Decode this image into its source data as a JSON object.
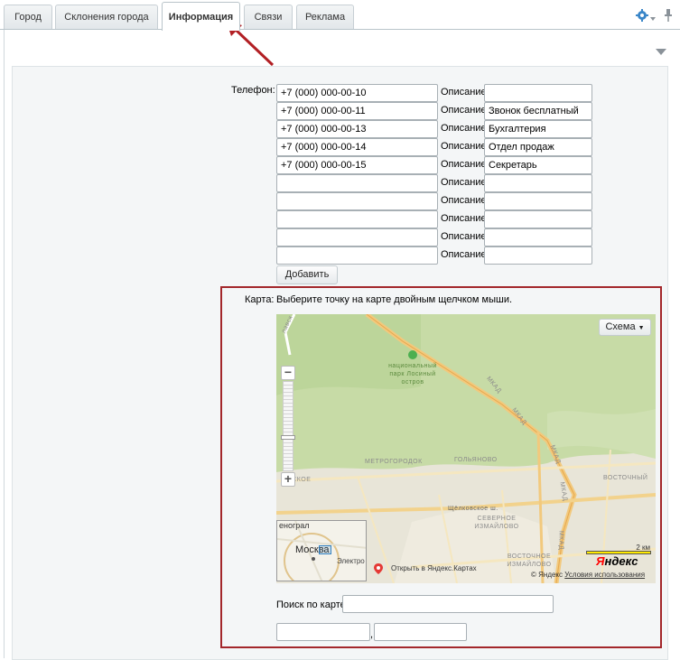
{
  "tabs": [
    {
      "label": "Город"
    },
    {
      "label": "Склонения города"
    },
    {
      "label": "Информация"
    },
    {
      "label": "Связи"
    },
    {
      "label": "Реклама"
    }
  ],
  "phone_section": {
    "label": "Телефон:",
    "desc_label": "Описание:",
    "rows": [
      {
        "phone": "+7 (000) 000-00-10",
        "desc": ""
      },
      {
        "phone": "+7 (000) 000-00-11",
        "desc": "Звонок бесплатный"
      },
      {
        "phone": "+7 (000) 000-00-13",
        "desc": "Бухгалтерия"
      },
      {
        "phone": "+7 (000) 000-00-14",
        "desc": "Отдел продаж"
      },
      {
        "phone": "+7 (000) 000-00-15",
        "desc": "Секретарь"
      },
      {
        "phone": "",
        "desc": ""
      },
      {
        "phone": "",
        "desc": ""
      },
      {
        "phone": "",
        "desc": ""
      },
      {
        "phone": "",
        "desc": ""
      },
      {
        "phone": "",
        "desc": ""
      }
    ],
    "add_button": "Добавить"
  },
  "map_section": {
    "label": "Карта:",
    "hint": "Выберите точку на карте двойным щелчком мыши.",
    "type_button": "Схема",
    "labels": {
      "park": "национальный парк Лосиный остров",
      "mkad1": "МКАД",
      "mkad2": "МКАД",
      "mkad3": "МКАД",
      "mkad4": "МКАД",
      "mkad5": "МКАД",
      "metrogorodok": "МЕТРОГОРОДОК",
      "golyanovo": "ГОЛЬЯНОВО",
      "vostochny": "ВОСТОЧНЫЙ",
      "shchelkovskoe": "Щёлковское ш.",
      "severnoe": "СЕВЕРНОЕ ИЗМАЙЛОВО",
      "vostochnoe": "ВОСТОЧНОЕ ИЗМАЙЛОВО",
      "dskoe": "ДСКОЕ",
      "slavsk": "лавск"
    },
    "minimap": {
      "city": "Москва",
      "top": "енограл",
      "side": "Электро"
    },
    "open_link": "Открыть в Яндекс.Картах",
    "scale": "2 км",
    "brand": "Яндекс",
    "copyright": "© Яндекс",
    "terms": "Условия использования"
  },
  "search": {
    "label": "Поиск по карте:",
    "value": ""
  },
  "coords": {
    "lat": "",
    "sep": ",",
    "lng": ""
  },
  "colors": {
    "highlight": "#a3272b",
    "accent": "#2f7fc1",
    "arrow": "#b21f24"
  }
}
